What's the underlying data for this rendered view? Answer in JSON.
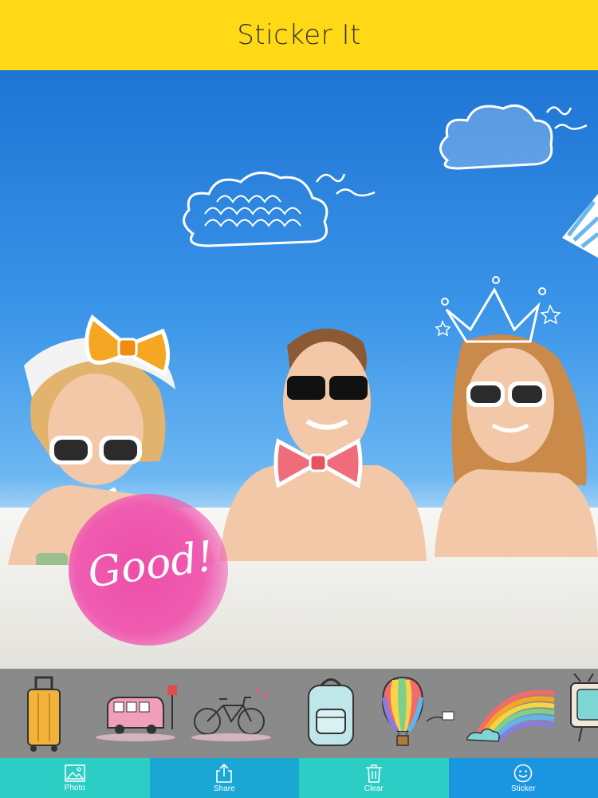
{
  "app": {
    "title": "Sticker It"
  },
  "canvas": {
    "good_text": "Good!"
  },
  "sticker_strip": {
    "items": [
      {
        "name": "suitcase-sticker"
      },
      {
        "name": "bus-sticker"
      },
      {
        "name": "bicycle-sticker"
      },
      {
        "name": "backpack-sticker"
      },
      {
        "name": "hot-air-balloon-sticker"
      },
      {
        "name": "rainbow-sticker"
      },
      {
        "name": "tv-sticker"
      }
    ]
  },
  "toolbar": {
    "photo_label": "Photo",
    "share_label": "Share",
    "clear_label": "Clear",
    "sticker_label": "Sticker"
  }
}
